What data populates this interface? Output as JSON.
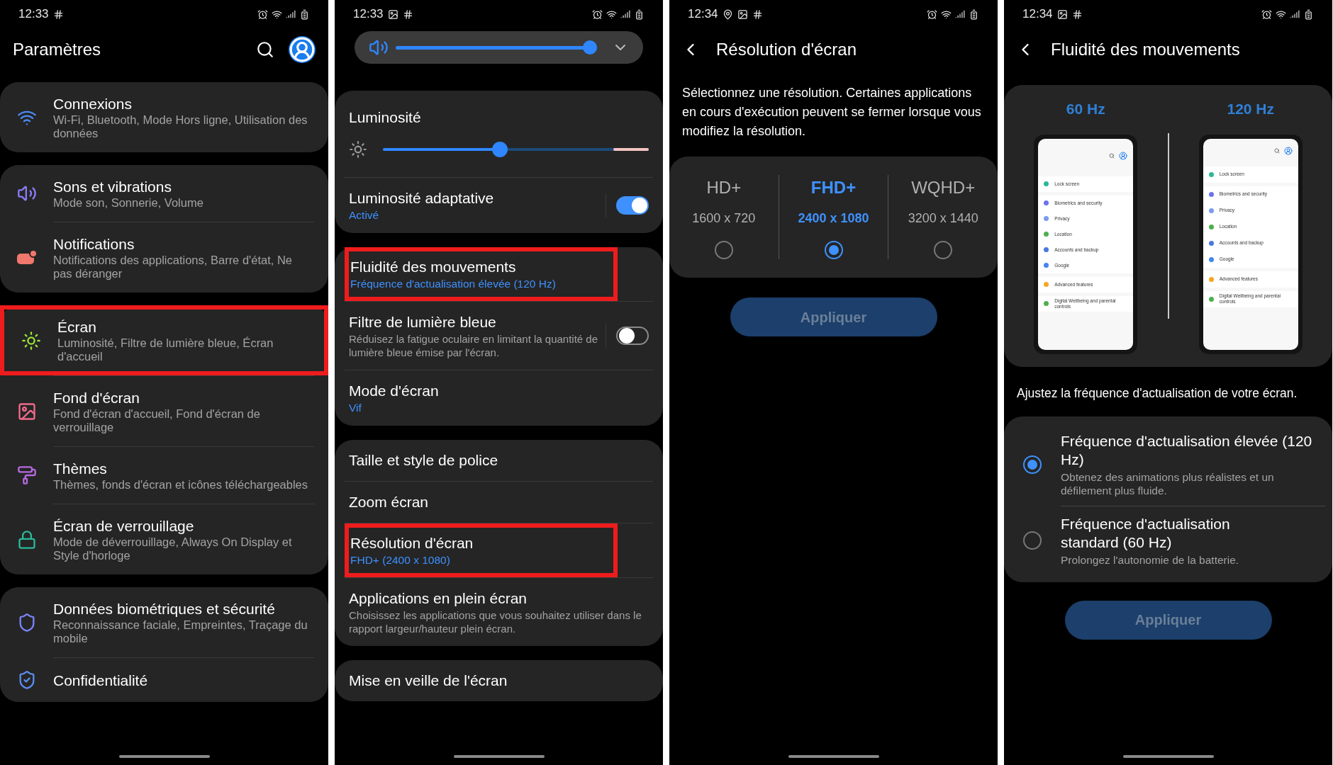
{
  "panels": [
    {
      "kind": "menu",
      "time": "12:33",
      "title": "Paramètres",
      "groups": [
        {
          "items": [
            {
              "title": "Connexions",
              "subtitle": "Wi-Fi, Bluetooth, Mode Hors ligne, Utilisation des données",
              "highlighted": false
            }
          ]
        },
        {
          "items": [
            {
              "title": "Sons et vibrations",
              "subtitle": "Mode son, Sonnerie, Volume",
              "highlighted": false
            },
            {
              "title": "Notifications",
              "subtitle": "Notifications des applications, Barre d'état, Ne pas déranger",
              "highlighted": false
            }
          ]
        },
        {
          "items": [
            {
              "title": "Écran",
              "subtitle": "Luminosité, Filtre de lumière bleue, Écran d'accueil",
              "highlighted": true
            },
            {
              "title": "Fond d'écran",
              "subtitle": "Fond d'écran d'accueil, Fond d'écran de verrouillage",
              "highlighted": false
            },
            {
              "title": "Thèmes",
              "subtitle": "Thèmes, fonds d'écran et icônes téléchargeables",
              "highlighted": false
            },
            {
              "title": "Écran de verrouillage",
              "subtitle": "Mode de déverrouillage, Always On Display et Style d'horloge",
              "highlighted": false
            }
          ]
        },
        {
          "items": [
            {
              "title": "Données biométriques et sécurité",
              "subtitle": "Reconnaissance faciale, Empreintes, Traçage du mobile",
              "highlighted": false
            },
            {
              "title": "Confidentialité",
              "highlighted": false
            }
          ]
        }
      ]
    },
    {
      "kind": "display",
      "time": "12:33",
      "volume": {
        "level": 0.96
      },
      "groups": [
        {
          "items": [
            {
              "kind": "slider",
              "title": "Luminosité",
              "level": 0.44
            },
            {
              "kind": "toggle",
              "title": "Luminosité adaptative",
              "value": "Activé",
              "on": true,
              "highlighted": false
            }
          ]
        },
        {
          "items": [
            {
              "kind": "row",
              "title": "Fluidité des mouvements",
              "value": "Fréquence d'actualisation élevée (120 Hz)",
              "highlighted": true
            },
            {
              "kind": "toggle",
              "title": "Filtre de lumière bleue",
              "subtitle": "Réduisez la fatigue oculaire en limitant la quantité de lumière bleue émise par l'écran.",
              "on": false,
              "highlighted": false
            },
            {
              "kind": "row",
              "title": "Mode d'écran",
              "value": "Vif",
              "highlighted": false
            }
          ]
        },
        {
          "items": [
            {
              "kind": "row",
              "title": "Taille et style de police",
              "highlighted": false
            },
            {
              "kind": "row",
              "title": "Zoom écran",
              "highlighted": false
            },
            {
              "kind": "row",
              "title": "Résolution d'écran",
              "value": "FHD+ (2400 x 1080)",
              "highlighted": true
            },
            {
              "kind": "row",
              "title": "Applications en plein écran",
              "subtitle": "Choisissez les applications que vous souhaitez utiliser dans le rapport largeur/hauteur plein écran.",
              "highlighted": false
            }
          ]
        },
        {
          "items": [
            {
              "kind": "row",
              "title": "Mise en veille de l'écran",
              "highlighted": false
            }
          ]
        }
      ]
    },
    {
      "kind": "resolution",
      "time": "12:34",
      "title": "Résolution d'écran",
      "description": "Sélectionnez une résolution. Certaines applications en cours d'exécution peuvent se fermer lorsque vous modifiez la résolution.",
      "options": [
        {
          "name": "HD+",
          "size": "1600 x 720",
          "selected": false
        },
        {
          "name": "FHD+",
          "size": "2400 x 1080",
          "selected": true
        },
        {
          "name": "WQHD+",
          "size": "3200 x 1440",
          "selected": false
        }
      ],
      "apply": {
        "label": "Appliquer",
        "disabled": true
      }
    },
    {
      "kind": "motion",
      "time": "12:34",
      "title": "Fluidité des mouvements",
      "previews": [
        {
          "label": "60 Hz",
          "items": [
            "Lock screen",
            "Biometrics and security",
            "Privacy",
            "Location",
            "Accounts and backup",
            "Google",
            "Advanced features",
            "Digital Wellbeing and parental controls"
          ]
        },
        {
          "label": "120 Hz",
          "items": [
            "Lock screen",
            "Biometrics and security",
            "Privacy",
            "Location",
            "Accounts and backup",
            "Google",
            "Advanced features",
            "Digital Wellbeing and parental controls"
          ]
        }
      ],
      "description": "Ajustez la fréquence d'actualisation de votre écran.",
      "options": [
        {
          "title": "Fréquence d'actualisation élevée (120 Hz)",
          "subtitle": "Obtenez des animations plus réalistes et un défilement plus fluide.",
          "selected": true
        },
        {
          "title": "Fréquence d'actualisation standard (60 Hz)",
          "subtitle": "Prolongez l'autonomie de la batterie.",
          "selected": false
        }
      ],
      "apply": {
        "label": "Appliquer",
        "disabled": true
      }
    }
  ]
}
